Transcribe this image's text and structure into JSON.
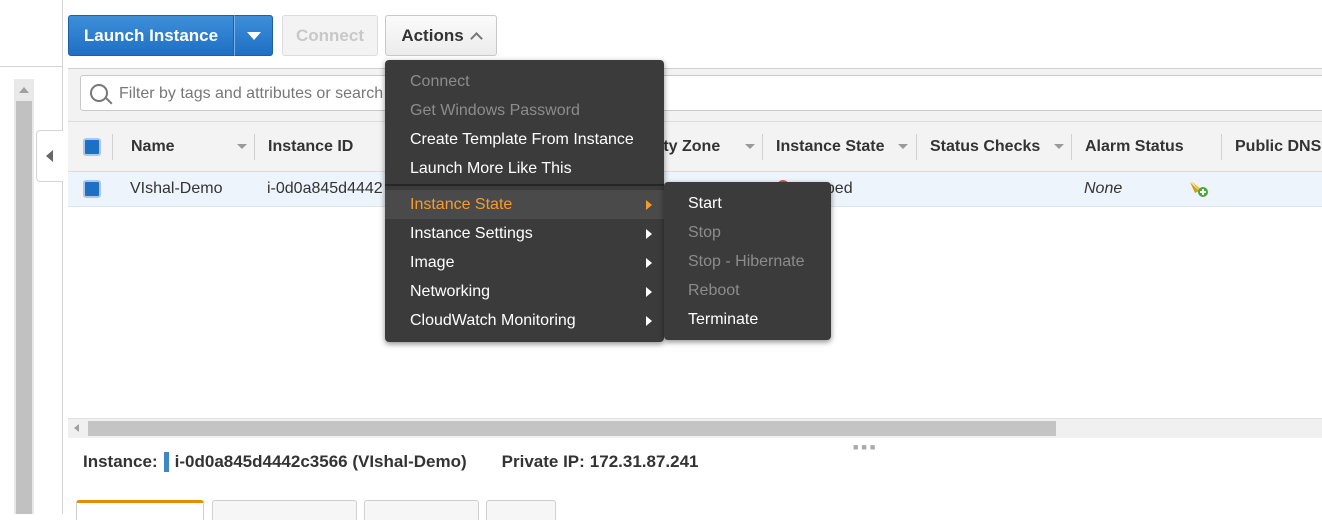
{
  "toolbar": {
    "launch_label": "Launch Instance",
    "connect_label": "Connect",
    "actions_label": "Actions"
  },
  "search": {
    "placeholder": "Filter by tags and attributes or search by keyword"
  },
  "table": {
    "columns": [
      "Name",
      "Instance ID",
      "Availability Zone",
      "Instance State",
      "Status Checks",
      "Alarm Status",
      "Public DNS"
    ],
    "visible_headers": {
      "name": "Name",
      "instance_id": "Instance ID",
      "az_partial": "ility Zone",
      "instance_state": "Instance State",
      "status_checks": "Status Checks",
      "alarm_status": "Alarm Status",
      "public_dns": "Public DNS"
    },
    "rows": [
      {
        "name": "VIshal-Demo",
        "instance_id_visible": "i-0d0a845d4442",
        "instance_state_visible": "pped",
        "alarm_status": "None"
      }
    ]
  },
  "actions_menu": {
    "items": [
      {
        "label": "Connect",
        "enabled": false
      },
      {
        "label": "Get Windows Password",
        "enabled": false
      },
      {
        "label": "Create Template From Instance",
        "enabled": true
      },
      {
        "label": "Launch More Like This",
        "enabled": true
      },
      {
        "label": "Instance State",
        "enabled": true,
        "submenu": true,
        "active": true
      },
      {
        "label": "Instance Settings",
        "enabled": true,
        "submenu": true
      },
      {
        "label": "Image",
        "enabled": true,
        "submenu": true
      },
      {
        "label": "Networking",
        "enabled": true,
        "submenu": true
      },
      {
        "label": "CloudWatch Monitoring",
        "enabled": true,
        "submenu": true
      }
    ]
  },
  "instance_state_submenu": {
    "items": [
      {
        "label": "Start",
        "enabled": true
      },
      {
        "label": "Stop",
        "enabled": false
      },
      {
        "label": "Stop - Hibernate",
        "enabled": false
      },
      {
        "label": "Reboot",
        "enabled": false
      },
      {
        "label": "Terminate",
        "enabled": true
      }
    ]
  },
  "details": {
    "instance_label": "Instance:",
    "instance_value": "i-0d0a845d4442c3566 (VIshal-Demo)",
    "private_ip_label": "Private IP:",
    "private_ip_value": "172.31.87.241"
  },
  "colors": {
    "primary_button": "#1f6fc4",
    "menu_background": "#3b3b3b",
    "menu_active_text": "#f79b2e",
    "selected_row": "#eef4fb",
    "stopped_state": "#d9534f",
    "active_tab_accent": "#e88b00"
  }
}
